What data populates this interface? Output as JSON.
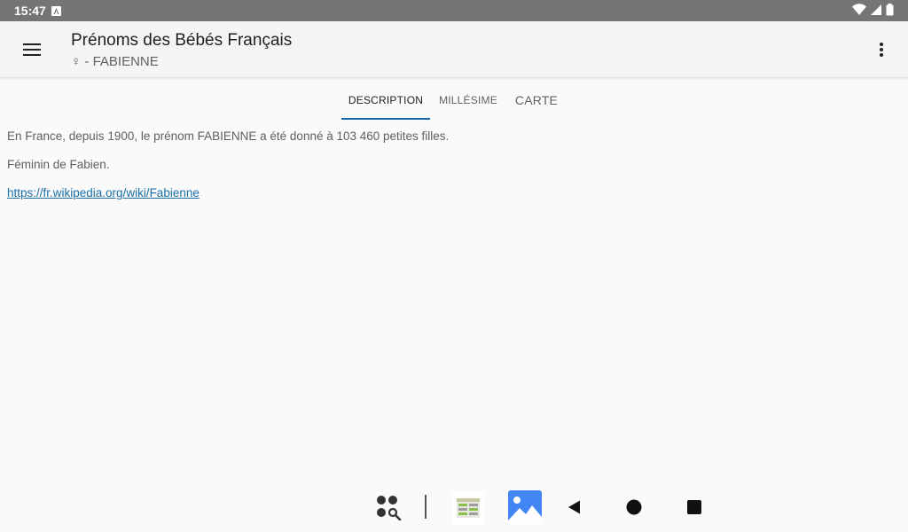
{
  "status_bar": {
    "time": "15:47",
    "icons": [
      "notification-a-icon",
      "wifi-icon",
      "signal-icon",
      "battery-icon"
    ]
  },
  "app_bar": {
    "title": "Prénoms des Bébés Français",
    "subtitle": "♀ - FABIENNE",
    "menu_icon": "hamburger-menu-icon",
    "overflow_icon": "more-vert-icon"
  },
  "tabs": [
    {
      "label": "DESCRIPTION",
      "selected": true
    },
    {
      "label": "MILLÉSIME",
      "selected": false
    },
    {
      "label": "CARTE",
      "selected": false
    }
  ],
  "content": {
    "paragraph_1": "En France, depuis 1900, le prénom FABIENNE a été donné à 103 460 petites filles.",
    "paragraph_2": "Féminin de Fabien.",
    "link": "https://fr.wikipedia.org/wiki/Fabienne"
  },
  "navigation_bar": {
    "items": [
      "app-search-icon",
      "spreadsheet-app-icon",
      "gallery-app-icon",
      "back-icon",
      "home-icon",
      "recents-icon"
    ]
  },
  "colors": {
    "status_bar": "#757575",
    "app_bar": "#f5f5f5",
    "tab_indicator": "#1565a6",
    "link": "#1a6fa8",
    "gallery_icon": "#4285f4"
  }
}
